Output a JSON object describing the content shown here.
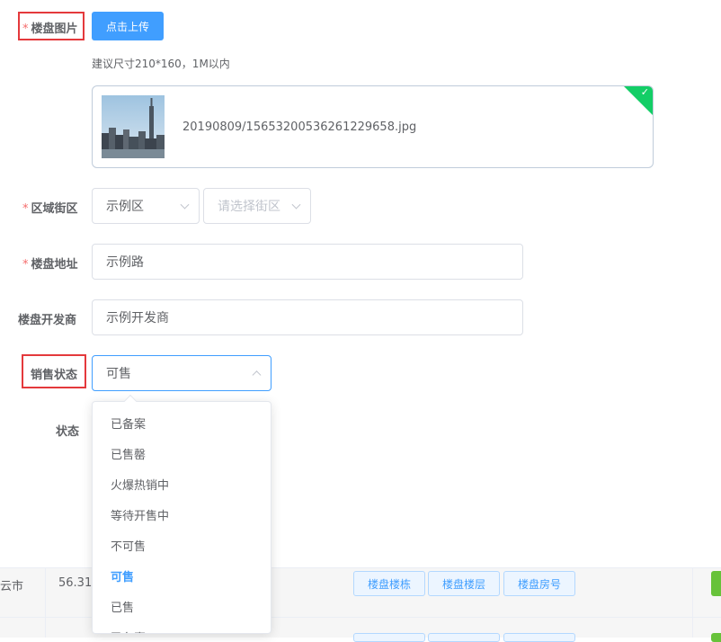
{
  "form": {
    "image": {
      "label": "楼盘图片",
      "required_mark": "*",
      "upload_button": "点击上传",
      "hint": "建议尺寸210*160，1M以内",
      "file_name": "20190809/15653200536261229658.jpg",
      "check_icon": "check-icon",
      "success_color": "#13ce66"
    },
    "district": {
      "label": "区域街区",
      "required_mark": "*",
      "area_value": "示例区",
      "street_placeholder": "请选择街区"
    },
    "address": {
      "label": "楼盘地址",
      "required_mark": "*",
      "value": "示例路"
    },
    "developer": {
      "label": "楼盘开发商",
      "value": "示例开发商"
    },
    "sale_status": {
      "label": "销售状态",
      "value": "可售",
      "options": [
        "已备案",
        "已售罄",
        "火爆热销中",
        "等待开售中",
        "不可售",
        "可售",
        "已售",
        "已备案"
      ],
      "selected_index": 5
    },
    "status": {
      "label": "状态"
    }
  },
  "table": {
    "row1": {
      "city": "云市",
      "number": "56.31",
      "actions": [
        "楼盘楼栋",
        "楼盘楼层",
        "楼盘房号"
      ]
    }
  },
  "colors": {
    "primary": "#409eff",
    "danger": "#f56c6c",
    "highlight_box": "#e4393c",
    "success": "#67c23a"
  }
}
